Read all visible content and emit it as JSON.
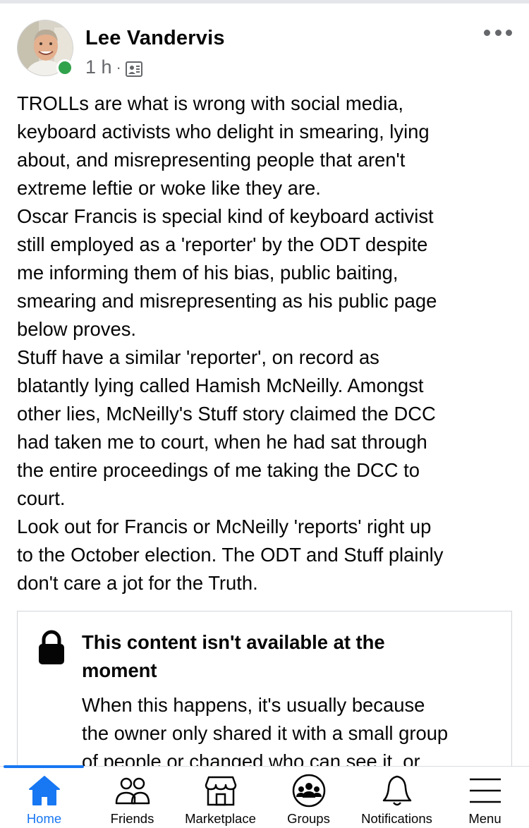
{
  "post": {
    "author": "Lee Vandervis",
    "time": "1 h",
    "separator": "·",
    "audience_icon": "public-page-icon",
    "paragraphs": [
      "TROLLs are what is wrong with social media,",
      "keyboard activists who delight in smearing, lying",
      "about, and misrepresenting people that aren't",
      "extreme leftie or woke like they are.",
      "Oscar Francis is special kind of keyboard activist",
      "still employed as a 'reporter' by the ODT despite",
      "me informing them of his bias, public baiting,",
      "smearing and misrepresenting as his public page",
      "below proves.",
      "Stuff have a similar 'reporter', on record as",
      "blatantly lying called Hamish McNeilly. Amongst",
      "other lies, McNeilly's Stuff story claimed the DCC",
      "had taken me to court, when he had sat through",
      "the entire proceedings of me taking the DCC to",
      "court.",
      "Look out for Francis or McNeilly 'reports' right up",
      "to the October election. The ODT and Stuff plainly",
      "don't care a jot for the Truth."
    ]
  },
  "shared": {
    "title_line1": "This content isn't available at the",
    "title_line2": "moment",
    "body_lines": [
      "When this happens, it's usually because",
      "the owner only shared it with a small group",
      "of people or changed who can see it, or"
    ]
  },
  "tabs": [
    {
      "label": "Home",
      "icon": "home-icon",
      "active": true
    },
    {
      "label": "Friends",
      "icon": "friends-icon",
      "active": false
    },
    {
      "label": "Marketplace",
      "icon": "marketplace-icon",
      "active": false
    },
    {
      "label": "Groups",
      "icon": "groups-icon",
      "active": false
    },
    {
      "label": "Notifications",
      "icon": "bell-icon",
      "active": false
    },
    {
      "label": "Menu",
      "icon": "menu-icon",
      "active": false
    }
  ],
  "colors": {
    "accent": "#1877f2",
    "online": "#31a24c",
    "secondary_text": "#65676b"
  }
}
